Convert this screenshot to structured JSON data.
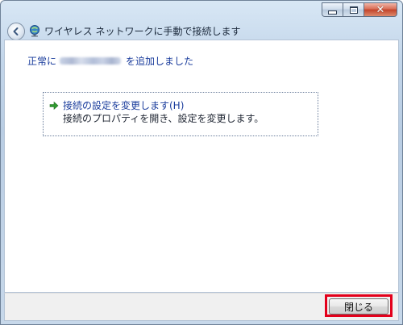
{
  "window": {
    "title": "ワイヤレス ネットワークに手動で接続します",
    "caption_buttons": {
      "minimize": "minimize",
      "maximize": "maximize",
      "close": "✕"
    }
  },
  "main": {
    "success_prefix": "正常に",
    "success_suffix": "を追加しました",
    "option": {
      "title": "接続の設定を変更します(H)",
      "description": "接続のプロパティを開き、設定を変更します。"
    }
  },
  "footer": {
    "close_label": "閉じる"
  },
  "colors": {
    "link_blue": "#1a3c9c",
    "highlight_red": "#e3001b",
    "arrow_green": "#2f9a2f"
  }
}
